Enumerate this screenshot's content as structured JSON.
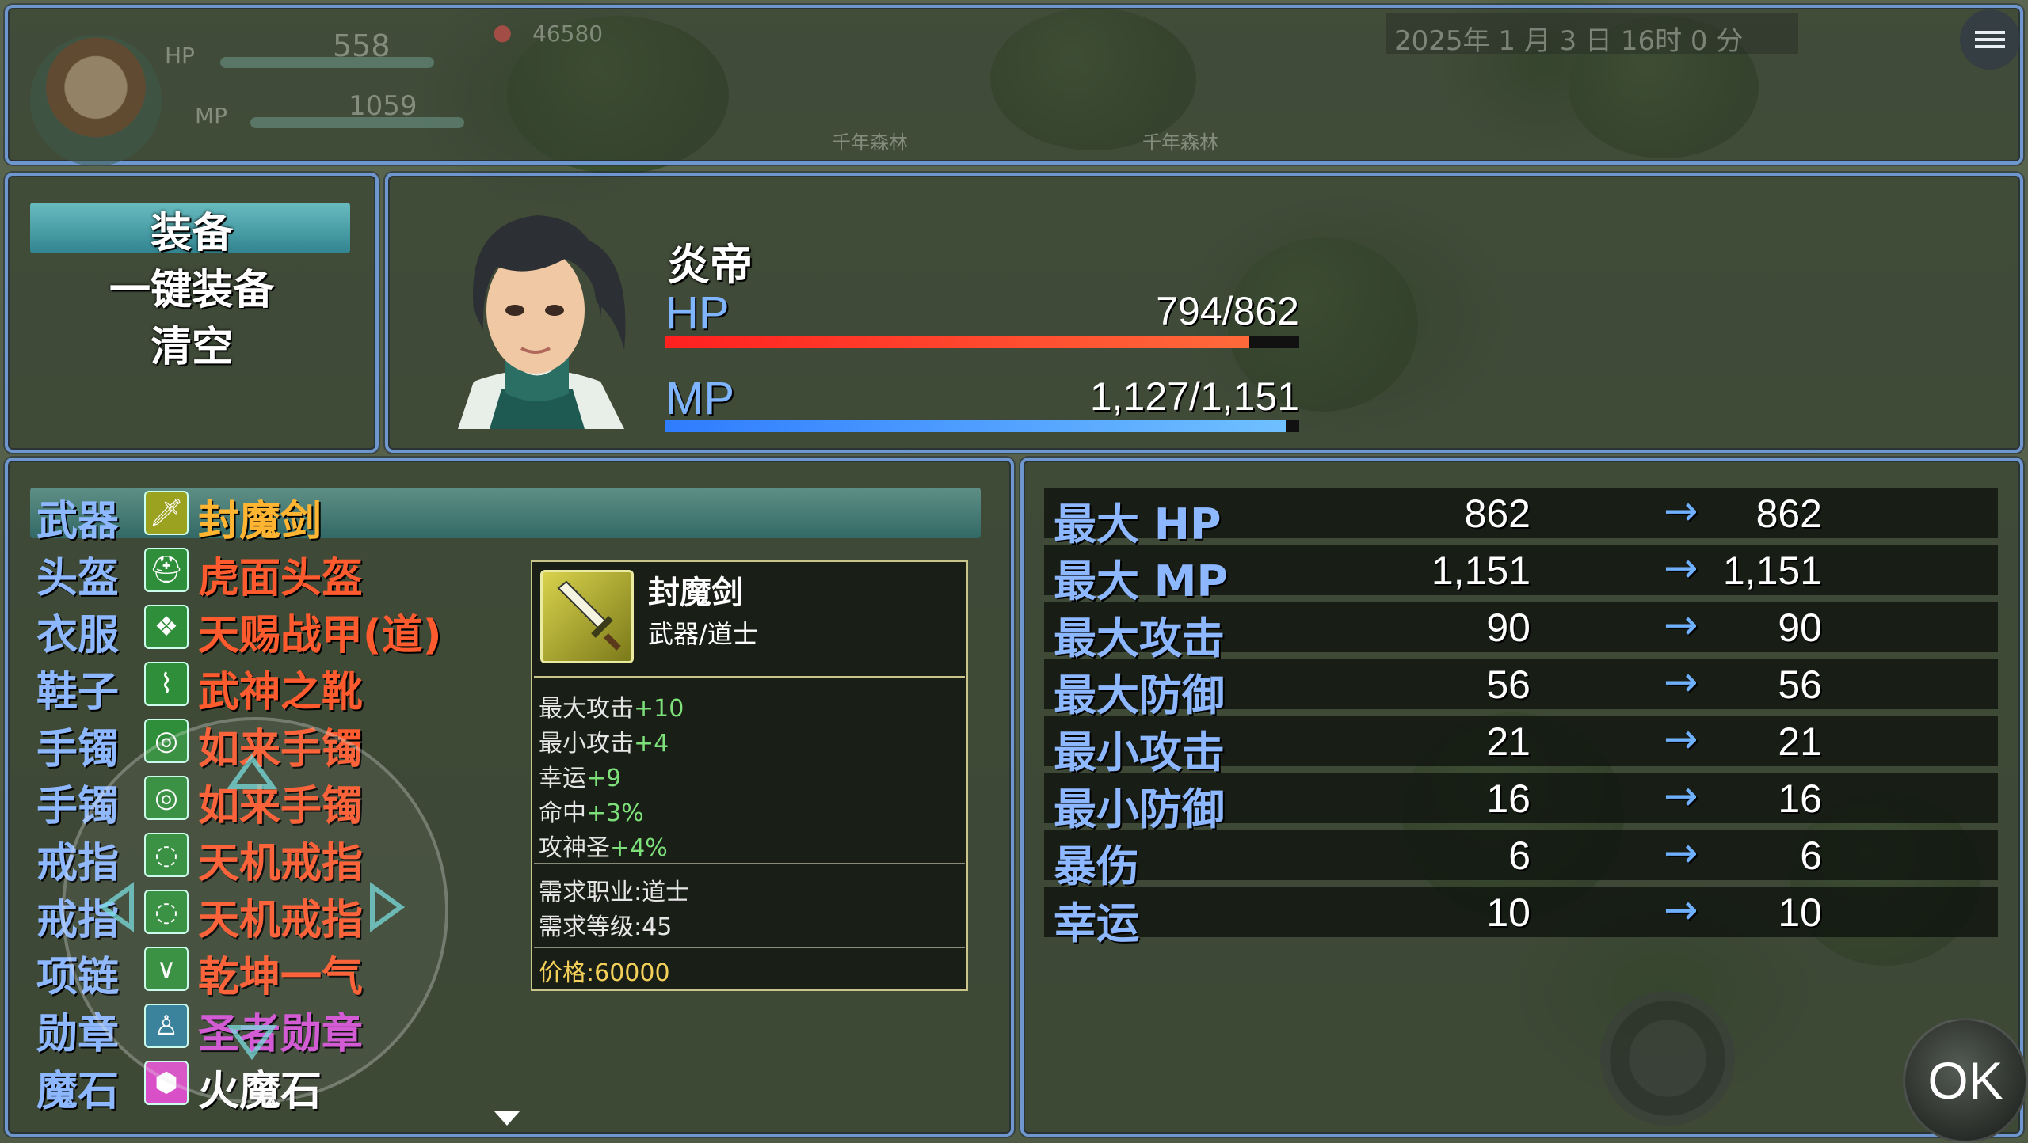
{
  "hud": {
    "hp_label": "HP",
    "hp_value": "558",
    "mp_label": "MP",
    "mp_value": "1059",
    "gold": "46580",
    "datetime": "2025年 1 月 3 日 16时 0 分",
    "map_label_1": "千年森林",
    "map_label_2": "千年森林"
  },
  "commands": {
    "equip": "装备",
    "optimize": "一键装备",
    "clear": "清空"
  },
  "actor": {
    "name": "炎帝",
    "hp_label": "HP",
    "hp_text": "794/862",
    "hp_ratio": 0.921,
    "mp_label": "MP",
    "mp_text": "1,127/1,151",
    "mp_ratio": 0.979
  },
  "slots": [
    {
      "type": "武器",
      "item": "封魔剑",
      "color": "#ffb531",
      "icon": "sword-icon",
      "icon_bg": "#9aa21f",
      "glyph": "🗡"
    },
    {
      "type": "头盔",
      "item": "虎面头盔",
      "color": "#ff5b2e",
      "icon": "helmet-icon",
      "icon_bg": "#2f8e3a",
      "glyph": "⛑"
    },
    {
      "type": "衣服",
      "item": "天赐战甲(道)",
      "color": "#ff5b2e",
      "icon": "armor-icon",
      "icon_bg": "#2f8e3a",
      "glyph": "❖"
    },
    {
      "type": "鞋子",
      "item": "武神之靴",
      "color": "#ff5b2e",
      "icon": "boots-icon",
      "icon_bg": "#2f8e3a",
      "glyph": "⌇"
    },
    {
      "type": "手镯",
      "item": "如来手镯",
      "color": "#ff5b2e",
      "icon": "bracelet-icon",
      "icon_bg": "#2f8e3a",
      "glyph": "◎"
    },
    {
      "type": "手镯",
      "item": "如来手镯",
      "color": "#ff5b2e",
      "icon": "bracelet-icon",
      "icon_bg": "#2f8e3a",
      "glyph": "◎"
    },
    {
      "type": "戒指",
      "item": "天机戒指",
      "color": "#ff5b2e",
      "icon": "ring-icon",
      "icon_bg": "#2f8e3a",
      "glyph": "◌"
    },
    {
      "type": "戒指",
      "item": "天机戒指",
      "color": "#ff5b2e",
      "icon": "ring-icon",
      "icon_bg": "#2f8e3a",
      "glyph": "◌"
    },
    {
      "type": "项链",
      "item": "乾坤一气",
      "color": "#ff5b2e",
      "icon": "necklace-icon",
      "icon_bg": "#2f8e3a",
      "glyph": "∨"
    },
    {
      "type": "勋章",
      "item": "圣者勋章",
      "color": "#d453d6",
      "icon": "medal-icon",
      "icon_bg": "#2f7d9a",
      "glyph": "♙"
    },
    {
      "type": "魔石",
      "item": "火魔石",
      "color": "#ffffff",
      "icon": "gem-icon",
      "icon_bg": "#d94fc8",
      "glyph": "⬢"
    }
  ],
  "tooltip": {
    "name": "封魔剑",
    "type": "武器/道士",
    "stats": [
      {
        "label": "最大攻击",
        "value": "+10"
      },
      {
        "label": "最小攻击",
        "value": "+4"
      },
      {
        "label": "幸运",
        "value": "+9"
      },
      {
        "label": "命中",
        "value": "+3%"
      },
      {
        "label": "攻神圣",
        "value": "+4%"
      }
    ],
    "req_class": "需求职业:道士",
    "req_level": "需求等级:45",
    "price": "价格:60000"
  },
  "params": [
    {
      "name": "最大 HP",
      "current": "862",
      "new": "862"
    },
    {
      "name": "最大 MP",
      "current": "1,151",
      "new": "1,151"
    },
    {
      "name": "最大攻击",
      "current": "90",
      "new": "90"
    },
    {
      "name": "最大防御",
      "current": "56",
      "new": "56"
    },
    {
      "name": "最小攻击",
      "current": "21",
      "new": "21"
    },
    {
      "name": "最小防御",
      "current": "16",
      "new": "16"
    },
    {
      "name": "暴伤",
      "current": "6",
      "new": "6"
    },
    {
      "name": "幸运",
      "current": "10",
      "new": "10"
    }
  ],
  "arrow_glyph": "→",
  "ok_label": "OK",
  "colors": {
    "hp_gauge": "#ff2a2a",
    "mp_gauge": "#3d8bff",
    "window_border": "#6f97cf"
  }
}
